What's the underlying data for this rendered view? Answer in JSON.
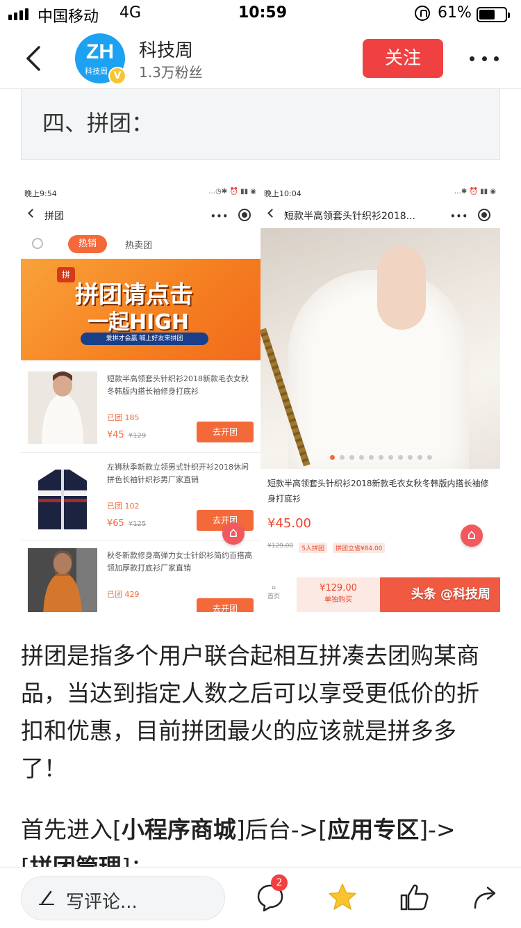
{
  "status_bar": {
    "carrier": "中国移动",
    "network": "4G",
    "time": "10:59",
    "battery": "61%",
    "battery_level": 0.61
  },
  "header": {
    "account_name": "科技周",
    "followers": "1.3万粉丝",
    "follow_label": "关注",
    "avatar_text": "ZH",
    "avatar_sub": "科技周"
  },
  "article": {
    "section_title": "四、拼团：",
    "paragraph1": "拼团是指多个用户联合起相互拼凑去团购某商品，当达到指定人数之后可以享受更低价的折扣和优惠，目前拼团最火的应该就是拼多多了！",
    "paragraph2_prefix": "首先进入[",
    "paragraph2_bold1": "小程序商城",
    "paragraph2_mid": "]后台->[",
    "paragraph2_bold2": "应用专区",
    "paragraph2_suffix": "]->",
    "paragraph3_prefix": "[",
    "paragraph3_bold": "拼团管理",
    "paragraph3_suffix": "]："
  },
  "screenshot": {
    "left": {
      "time": "晚上9:54",
      "title": "拼团",
      "tab_active": "热销",
      "tab_other": "热卖团",
      "banner_tag": "拼",
      "banner_line1": "拼团请点击",
      "banner_line2": "一起HIGH",
      "banner_line3": "爱拼才会赢 喊上好友来拼团",
      "products": [
        {
          "name": "短款半高领套头针织衫2018新款毛衣女秋冬韩版内搭长袖修身打底衫",
          "joined": "已团 185",
          "price": "¥45",
          "old_price": "¥129",
          "button": "去开团"
        },
        {
          "name": "左狮秋季新款立领男式针织开衫2018休闲拼色长袖针织衫男厂家直销",
          "joined": "已团 102",
          "price": "¥65",
          "old_price": "¥125",
          "button": "去开团"
        },
        {
          "name": "秋冬新款修身高弹力女士针织衫简约百搭高领加厚款打底衫厂家直销",
          "joined": "已团 429",
          "price": "",
          "old_price": "",
          "button": "去开团"
        }
      ]
    },
    "right": {
      "time": "晚上10:04",
      "title": "短款半高领套头针织衫2018...",
      "product_name": "短款半高领套头针织衫2018新款毛衣女秋冬韩版内搭长袖修身打底衫",
      "price": "¥45.00",
      "old_price": "¥129.00",
      "tag1": "5人拼团",
      "tag2": "拼团立省¥84.00",
      "home_label": "首页",
      "single_price": "¥129.00",
      "single_label": "单独购买",
      "watermark": "头条 @科技周"
    }
  },
  "bottom_bar": {
    "comment_placeholder": "写评论...",
    "comment_count": "2"
  }
}
